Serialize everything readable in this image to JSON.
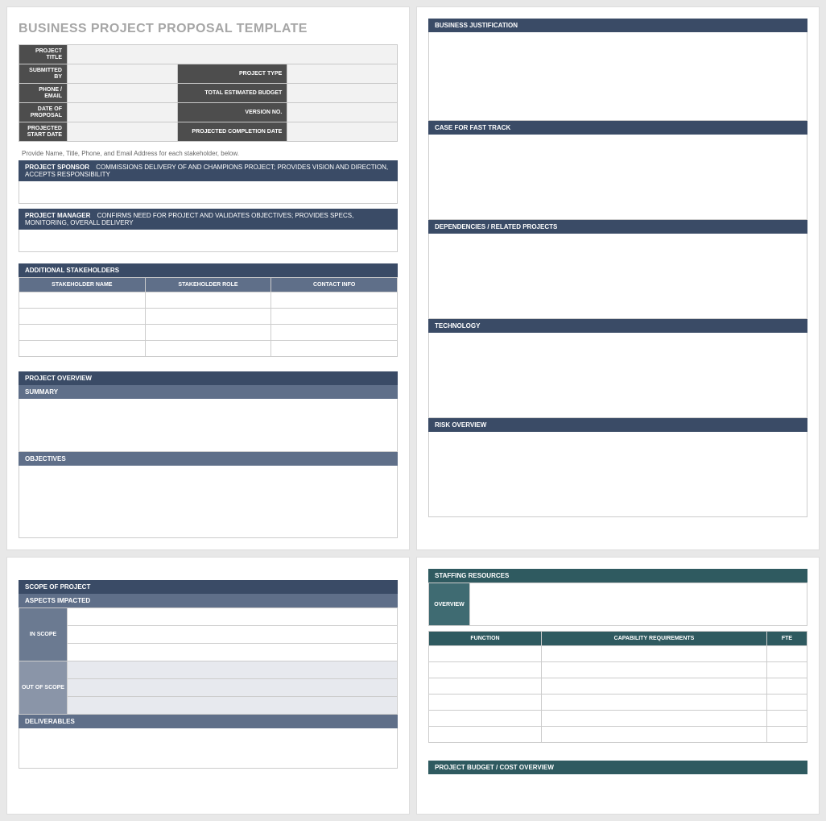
{
  "title": "BUSINESS PROJECT PROPOSAL TEMPLATE",
  "meta": {
    "project_title": "PROJECT TITLE",
    "submitted_by": "SUBMITTED BY",
    "project_type": "PROJECT TYPE",
    "phone_email": "PHONE / EMAIL",
    "total_estimated_budget": "TOTAL ESTIMATED BUDGET",
    "date_of_proposal": "DATE OF PROPOSAL",
    "version_no": "VERSION NO.",
    "projected_start_date": "PROJECTED START DATE",
    "projected_completion_date": "PROJECTED COMPLETION DATE"
  },
  "stakeholder_note": "Provide Name, Title, Phone, and Email Address for each stakeholder, below.",
  "sponsor": {
    "label": "PROJECT SPONSOR",
    "desc": "Commissions delivery of and champions project; Provides vision and direction, accepts responsibility"
  },
  "manager": {
    "label": "PROJECT MANAGER",
    "desc": "Confirms need for project and validates objectives; Provides specs, monitoring, overall delivery"
  },
  "additional_stakeholders": {
    "heading": "ADDITIONAL STAKEHOLDERS",
    "cols": [
      "STAKEHOLDER NAME",
      "STAKEHOLDER ROLE",
      "CONTACT INFO"
    ]
  },
  "overview": {
    "heading": "PROJECT OVERVIEW",
    "summary": "SUMMARY",
    "objectives": "OBJECTIVES"
  },
  "right": {
    "business_justification": "BUSINESS JUSTIFICATION",
    "case_for_fast_track": "CASE FOR FAST TRACK",
    "dependencies": "DEPENDENCIES / RELATED PROJECTS",
    "technology": "TECHNOLOGY",
    "risk_overview": "RISK OVERVIEW"
  },
  "scope": {
    "heading": "SCOPE OF PROJECT",
    "aspects": "ASPECTS IMPACTED",
    "in_scope": "IN SCOPE",
    "out_of_scope": "OUT OF SCOPE",
    "deliverables": "DELIVERABLES"
  },
  "staffing": {
    "heading": "STAFFING RESOURCES",
    "overview": "OVERVIEW",
    "cols": [
      "FUNCTION",
      "CAPABILITY REQUIREMENTS",
      "FTE"
    ],
    "budget_heading": "PROJECT BUDGET / COST OVERVIEW"
  }
}
